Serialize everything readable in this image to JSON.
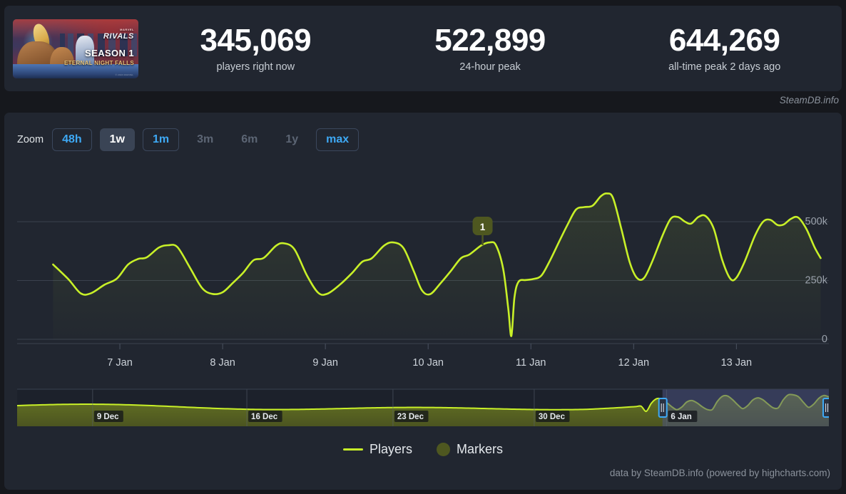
{
  "header": {
    "capsule": {
      "name": "marvel-rivals-season-1-capsule",
      "brand": "MARVEL",
      "title": "RIVALS",
      "season": "SEASON 1",
      "subtitle": "ETERNAL NIGHT FALLS",
      "credit": "© 2024 MARVEL"
    },
    "stats": [
      {
        "value": "345,069",
        "label": "players right now"
      },
      {
        "value": "522,899",
        "label": "24-hour peak"
      },
      {
        "value": "644,269",
        "label": "all-time peak 2 days ago"
      }
    ]
  },
  "watermark": "SteamDB.info",
  "toolbar": {
    "zoom_label": "Zoom",
    "buttons": [
      {
        "label": "48h",
        "state": "outlined"
      },
      {
        "label": "1w",
        "state": "active"
      },
      {
        "label": "1m",
        "state": "outlined"
      },
      {
        "label": "3m",
        "state": "disabled"
      },
      {
        "label": "6m",
        "state": "disabled"
      },
      {
        "label": "1y",
        "state": "disabled"
      },
      {
        "label": "max",
        "state": "outlined"
      }
    ]
  },
  "legend": [
    {
      "label": "Players",
      "marker": "line",
      "color": "#c8f028"
    },
    {
      "label": "Markers",
      "marker": "dot",
      "color": "#4e5720"
    }
  ],
  "credit": "data by SteamDB.info (powered by highcharts.com)",
  "colors": {
    "page_background": "#16181d",
    "panel_background": "#212630",
    "series_line": "#c8f028",
    "accent_blue": "#3ea9f5",
    "grid_line": "#3a414e",
    "navigator_fill": "#4e5720",
    "navigator_selection": "#4d5480",
    "marker_flag": "#4e5720"
  },
  "chart_data": {
    "type": "line",
    "title": "",
    "xlabel": "",
    "ylabel": "",
    "ylim": [
      0,
      700000
    ],
    "grid": true,
    "legend_position": "bottom",
    "y_ticks": [
      {
        "value": 0,
        "label": "0"
      },
      {
        "value": 250000,
        "label": "250k"
      },
      {
        "value": 500000,
        "label": "500k"
      }
    ],
    "x_ticks": [
      "7 Jan",
      "8 Jan",
      "9 Jan",
      "10 Jan",
      "11 Jan",
      "12 Jan",
      "13 Jan"
    ],
    "annotations": [
      {
        "label": "1",
        "x": "10 Jan",
        "y": 400000,
        "kind": "marker-flag"
      }
    ],
    "series": [
      {
        "name": "Players",
        "color": "#c8f028",
        "points": [
          {
            "t": 6.35,
            "v": 318000
          },
          {
            "t": 6.5,
            "v": 255000
          },
          {
            "t": 6.62,
            "v": 195000
          },
          {
            "t": 6.72,
            "v": 196000
          },
          {
            "t": 6.85,
            "v": 232000
          },
          {
            "t": 6.97,
            "v": 258000
          },
          {
            "t": 7.08,
            "v": 318000
          },
          {
            "t": 7.18,
            "v": 342000
          },
          {
            "t": 7.26,
            "v": 348000
          },
          {
            "t": 7.38,
            "v": 390000
          },
          {
            "t": 7.47,
            "v": 400000
          },
          {
            "t": 7.56,
            "v": 392000
          },
          {
            "t": 7.68,
            "v": 306000
          },
          {
            "t": 7.8,
            "v": 218000
          },
          {
            "t": 7.9,
            "v": 193000
          },
          {
            "t": 8.0,
            "v": 200000
          },
          {
            "t": 8.1,
            "v": 240000
          },
          {
            "t": 8.2,
            "v": 283000
          },
          {
            "t": 8.3,
            "v": 336000
          },
          {
            "t": 8.4,
            "v": 346000
          },
          {
            "t": 8.52,
            "v": 398000
          },
          {
            "t": 8.6,
            "v": 408000
          },
          {
            "t": 8.7,
            "v": 382000
          },
          {
            "t": 8.82,
            "v": 272000
          },
          {
            "t": 8.93,
            "v": 198000
          },
          {
            "t": 9.02,
            "v": 194000
          },
          {
            "t": 9.14,
            "v": 232000
          },
          {
            "t": 9.26,
            "v": 282000
          },
          {
            "t": 9.36,
            "v": 330000
          },
          {
            "t": 9.45,
            "v": 344000
          },
          {
            "t": 9.57,
            "v": 398000
          },
          {
            "t": 9.66,
            "v": 412000
          },
          {
            "t": 9.76,
            "v": 388000
          },
          {
            "t": 9.86,
            "v": 290000
          },
          {
            "t": 9.94,
            "v": 208000
          },
          {
            "t": 10.02,
            "v": 192000
          },
          {
            "t": 10.12,
            "v": 238000
          },
          {
            "t": 10.22,
            "v": 290000
          },
          {
            "t": 10.32,
            "v": 345000
          },
          {
            "t": 10.4,
            "v": 360000
          },
          {
            "t": 10.52,
            "v": 400000
          },
          {
            "t": 10.6,
            "v": 412000
          },
          {
            "t": 10.66,
            "v": 400000
          },
          {
            "t": 10.73,
            "v": 300000
          },
          {
            "t": 10.78,
            "v": 130000
          },
          {
            "t": 10.81,
            "v": 14000
          },
          {
            "t": 10.84,
            "v": 178000
          },
          {
            "t": 10.88,
            "v": 245000
          },
          {
            "t": 10.95,
            "v": 252000
          },
          {
            "t": 11.02,
            "v": 256000
          },
          {
            "t": 11.1,
            "v": 270000
          },
          {
            "t": 11.18,
            "v": 330000
          },
          {
            "t": 11.28,
            "v": 420000
          },
          {
            "t": 11.36,
            "v": 490000
          },
          {
            "t": 11.44,
            "v": 552000
          },
          {
            "t": 11.52,
            "v": 562000
          },
          {
            "t": 11.6,
            "v": 568000
          },
          {
            "t": 11.68,
            "v": 608000
          },
          {
            "t": 11.74,
            "v": 620000
          },
          {
            "t": 11.8,
            "v": 600000
          },
          {
            "t": 11.88,
            "v": 470000
          },
          {
            "t": 11.96,
            "v": 330000
          },
          {
            "t": 12.03,
            "v": 262000
          },
          {
            "t": 12.1,
            "v": 260000
          },
          {
            "t": 12.18,
            "v": 330000
          },
          {
            "t": 12.28,
            "v": 440000
          },
          {
            "t": 12.36,
            "v": 512000
          },
          {
            "t": 12.43,
            "v": 520000
          },
          {
            "t": 12.5,
            "v": 500000
          },
          {
            "t": 12.56,
            "v": 492000
          },
          {
            "t": 12.63,
            "v": 520000
          },
          {
            "t": 12.7,
            "v": 524000
          },
          {
            "t": 12.78,
            "v": 470000
          },
          {
            "t": 12.86,
            "v": 340000
          },
          {
            "t": 12.94,
            "v": 258000
          },
          {
            "t": 13.0,
            "v": 262000
          },
          {
            "t": 13.08,
            "v": 330000
          },
          {
            "t": 13.18,
            "v": 440000
          },
          {
            "t": 13.26,
            "v": 500000
          },
          {
            "t": 13.33,
            "v": 508000
          },
          {
            "t": 13.4,
            "v": 486000
          },
          {
            "t": 13.46,
            "v": 488000
          },
          {
            "t": 13.53,
            "v": 512000
          },
          {
            "t": 13.6,
            "v": 518000
          },
          {
            "t": 13.68,
            "v": 470000
          },
          {
            "t": 13.76,
            "v": 392000
          },
          {
            "t": 13.82,
            "v": 345000
          }
        ]
      }
    ],
    "navigator": {
      "x_ticks": [
        "9 Dec",
        "16 Dec",
        "23 Dec",
        "30 Dec",
        "6 Jan"
      ],
      "selection": {
        "from": "6 Jan",
        "to": "13 Jan"
      },
      "series_color": "#c8f028"
    }
  }
}
